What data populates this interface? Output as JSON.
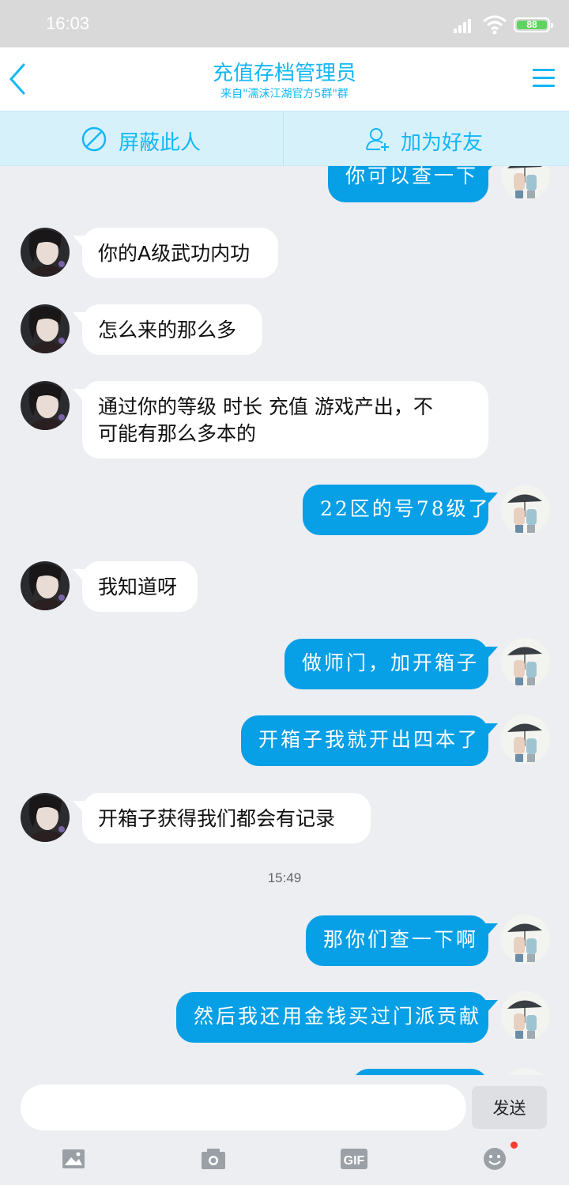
{
  "status_bar": {
    "time": "16:03",
    "battery": "88"
  },
  "header": {
    "title": "充值存档管理员",
    "subtitle": "来自\"濡沫江湖官方5群\"群"
  },
  "actions": {
    "block": "屏蔽此人",
    "add_friend": "加为好友"
  },
  "messages": [
    {
      "from": "me",
      "text": "你可以查一下"
    },
    {
      "from": "them",
      "text": "你的A级武功内功"
    },
    {
      "from": "them",
      "text": "怎么来的那么多"
    },
    {
      "from": "them",
      "text_line1": "通过你的等级 时长 充值 游戏产出，不",
      "text_line2": "可能有那么多本的"
    },
    {
      "from": "me",
      "text": "22区的号78级了"
    },
    {
      "from": "them",
      "text": "我知道呀"
    },
    {
      "from": "me",
      "text": "做师门，加开箱子"
    },
    {
      "from": "me",
      "text": "开箱子我就开出四本了"
    },
    {
      "from": "them",
      "text": "开箱子获得我们都会有记录"
    },
    {
      "timestamp": "15:49"
    },
    {
      "from": "me",
      "text": "那你们查一下啊"
    },
    {
      "from": "me",
      "text": "然后我还用金钱买过门派贡献"
    }
  ],
  "input": {
    "placeholder": "",
    "send_label": "发送"
  },
  "toolbar": {
    "gif_label": "GIF"
  },
  "colors": {
    "accent": "#12b7f5",
    "my_bubble": "#079fe5",
    "background": "#edeef2"
  }
}
